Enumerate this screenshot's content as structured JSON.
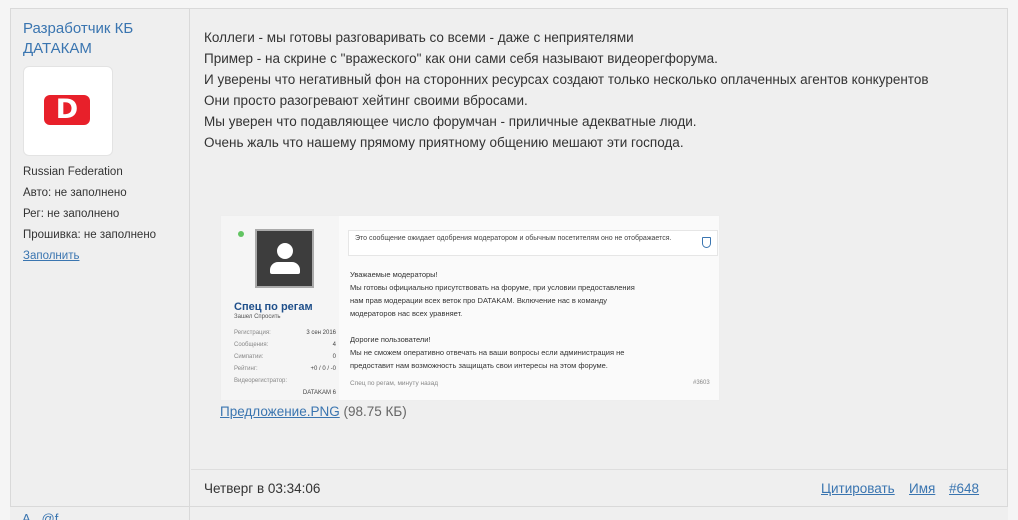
{
  "author": {
    "name": "Разработчик КБ ДАТАКАМ",
    "avatar_letter": "D",
    "country": "Russian Federation",
    "auto": "Авто: не заполнено",
    "reg": "Рег: не заполнено",
    "firmware": "Прошивка: не заполнено",
    "fill_link": "Заполнить"
  },
  "post": {
    "lines": [
      "Коллеги - мы готовы разговаривать со всеми - даже с неприятелями",
      "Пример - на скрине с \"вражеского\" как они сами себя называют видеорегфорума.",
      "И уверены что негативный фон на сторонних ресурсах создают только несколько оплаченных агентов конкурентов",
      "Они просто разогревают хейтинг своими вбросами.",
      "Мы уверен что подавляющее число форумчан - приличные адекватные люди.",
      "Очень жаль что нашему прямому приятному общению мешают эти господа."
    ],
    "attachment": {
      "filename": "Предложение.PNG",
      "size": "(98.75 КБ)"
    },
    "screenshot": {
      "username": "Спец по регам",
      "usersub": "Зашел Спросить",
      "stats": [
        {
          "label": "Регистрация:",
          "value": "3 сен 2016"
        },
        {
          "label": "Сообщения:",
          "value": "4"
        },
        {
          "label": "Симпатии:",
          "value": "0"
        },
        {
          "label": "Рейтинг:",
          "value": "+0 / 0 / -0"
        },
        {
          "label": "Видеорегистратор:",
          "value": ""
        },
        {
          "label": "",
          "value": "DATAKAM 6"
        }
      ],
      "notice": "Это сообщение ожидает одобрения модератором и обычным посетителям оно не отображается.",
      "message": [
        "Уважаемые модераторы!",
        "Мы готовы официально присутствовать на форуме, при условии предоставления",
        "нам прав модерации всех веток про DATAKAM. Включение нас в команду",
        "модераторов нас всех уравняет.",
        "",
        "Дорогие пользователи!",
        "Мы не сможем оперативно отвечать на ваши вопросы если администрация не",
        "предоставит нам возможность защищать свои интересы на этом форуме."
      ],
      "footer": "Спец по регам, минуту назад",
      "post_number": "#3603"
    }
  },
  "footer": {
    "date": "Четверг в 03:34:06",
    "quote": "Цитировать",
    "name": "Имя",
    "post_id": "#648"
  },
  "next_post": {
    "peek": "A...@f..."
  }
}
